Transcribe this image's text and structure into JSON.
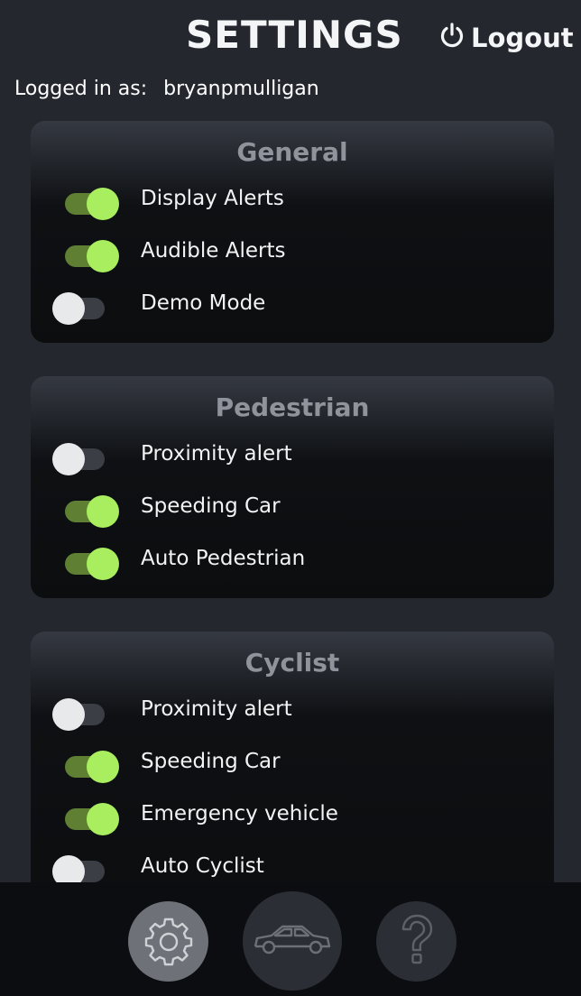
{
  "header": {
    "title": "SETTINGS",
    "logout_label": "Logout"
  },
  "user": {
    "logged_in_label": "Logged in as:",
    "username": "bryanpmulligan"
  },
  "sections": [
    {
      "title": "General",
      "items": [
        {
          "label": "Display Alerts",
          "on": true
        },
        {
          "label": "Audible Alerts",
          "on": true
        },
        {
          "label": "Demo Mode",
          "on": false
        }
      ]
    },
    {
      "title": "Pedestrian",
      "items": [
        {
          "label": "Proximity alert",
          "on": false
        },
        {
          "label": "Speeding Car",
          "on": true
        },
        {
          "label": "Auto Pedestrian",
          "on": true
        }
      ]
    },
    {
      "title": "Cyclist",
      "items": [
        {
          "label": "Proximity alert",
          "on": false
        },
        {
          "label": "Speeding Car",
          "on": true
        },
        {
          "label": "Emergency vehicle",
          "on": true
        },
        {
          "label": "Auto Cyclist",
          "on": false
        }
      ]
    }
  ],
  "nav": [
    {
      "icon": "gear-icon",
      "active": true
    },
    {
      "icon": "car-icon",
      "active": false
    },
    {
      "icon": "question-icon",
      "active": false
    }
  ],
  "colors": {
    "toggle_on": "#a8ee5f",
    "toggle_off": "#e8e9ea",
    "background": "#24272e"
  }
}
